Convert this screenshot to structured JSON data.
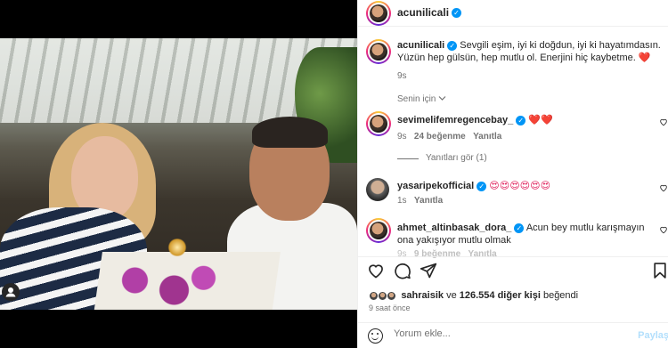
{
  "header": {
    "username": "acunilicali",
    "verified_icon": "verified-badge-icon"
  },
  "caption": {
    "username": "acunilicali",
    "text": "Sevgili eşim, iyi ki doğdun, iyi ki hayatımdasın. Yüzün hep gülsün, hep mutlu ol. Enerjini hiç kaybetme.",
    "emoji": "❤️",
    "time": "9s",
    "for_you": "Senin için"
  },
  "comments": [
    {
      "username": "sevimelifemregencebay_",
      "text": "❤️❤️",
      "time": "9s",
      "likes": "24 beğenme",
      "reply": "Yanıtla",
      "view_replies": "Yanıtları gör (1)"
    },
    {
      "username": "yasaripekofficial",
      "text": "😍😍😍😍😍😍",
      "time": "1s",
      "reply": "Yanıtla"
    },
    {
      "username": "ahmet_altinbasak_dora_",
      "text": "Acun bey mutlu karışmayın ona yakışıyor mutlu olmak",
      "time": "9s",
      "likes": "9 beğenme",
      "reply": "Yanıtla"
    }
  ],
  "likes": {
    "first_user": "sahraisik",
    "connector": "ve",
    "others": "126.554 diğer kişi",
    "suffix": "beğendi"
  },
  "posted_ago": "9 saat önce",
  "comment_box": {
    "placeholder": "Yorum ekle...",
    "post_label": "Paylaş"
  },
  "colors": {
    "verified": "#0095f6",
    "heart": "#ed4956",
    "muted": "#737373",
    "post_button_disabled": "#b2dffc"
  }
}
